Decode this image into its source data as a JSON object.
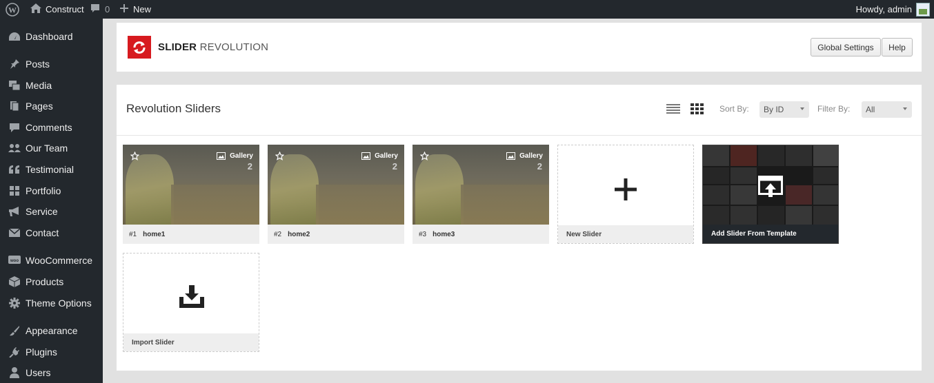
{
  "adminbar": {
    "site_name": "Construct",
    "comments_count": "0",
    "new_label": "New",
    "howdy": "Howdy, admin"
  },
  "sidebar": {
    "items": [
      {
        "label": "Dashboard",
        "icon": "dashboard-icon"
      },
      {
        "label": "Posts",
        "icon": "pin-icon"
      },
      {
        "label": "Media",
        "icon": "media-icon"
      },
      {
        "label": "Pages",
        "icon": "pages-icon"
      },
      {
        "label": "Comments",
        "icon": "comments-icon"
      },
      {
        "label": "Our Team",
        "icon": "team-icon"
      },
      {
        "label": "Testimonial",
        "icon": "quote-icon"
      },
      {
        "label": "Portfolio",
        "icon": "grid-icon"
      },
      {
        "label": "Service",
        "icon": "megaphone-icon"
      },
      {
        "label": "Contact",
        "icon": "mail-icon"
      },
      {
        "label": "WooCommerce",
        "icon": "woo-icon"
      },
      {
        "label": "Products",
        "icon": "box-icon"
      },
      {
        "label": "Theme Options",
        "icon": "gear-icon"
      },
      {
        "label": "Appearance",
        "icon": "brush-icon"
      },
      {
        "label": "Plugins",
        "icon": "plug-icon"
      },
      {
        "label": "Users",
        "icon": "user-icon"
      }
    ]
  },
  "header": {
    "logo_bold": "SLIDER",
    "logo_light": "REVOLUTION",
    "global_settings": "Global Settings",
    "help": "Help"
  },
  "main": {
    "title": "Revolution Sliders",
    "sort_label": "Sort By:",
    "sort_value": "By ID",
    "filter_label": "Filter By:",
    "filter_value": "All",
    "sliders": [
      {
        "num": "#1",
        "name": "home1",
        "type": "Gallery",
        "count": "2"
      },
      {
        "num": "#2",
        "name": "home2",
        "type": "Gallery",
        "count": "2"
      },
      {
        "num": "#3",
        "name": "home3",
        "type": "Gallery",
        "count": "2"
      }
    ],
    "new_slider": "New Slider",
    "add_from_template": "Add Slider From Template",
    "import_slider": "Import Slider"
  },
  "colors": {
    "admin_dark": "#23282d",
    "brand_red": "#d71a1f",
    "panel_bg": "#ffffff",
    "page_bg": "#e1e1e1"
  }
}
